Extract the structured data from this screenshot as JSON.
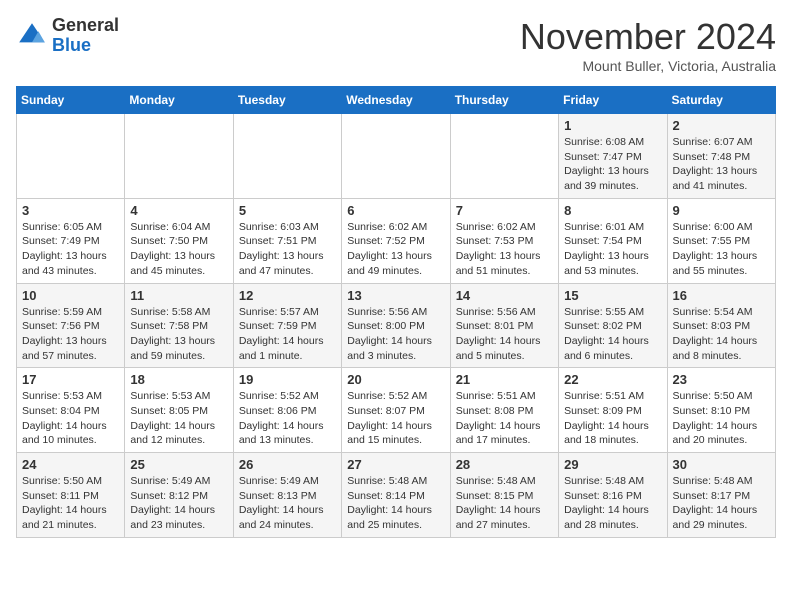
{
  "header": {
    "logo_general": "General",
    "logo_blue": "Blue",
    "month": "November 2024",
    "location": "Mount Buller, Victoria, Australia"
  },
  "days_of_week": [
    "Sunday",
    "Monday",
    "Tuesday",
    "Wednesday",
    "Thursday",
    "Friday",
    "Saturday"
  ],
  "weeks": [
    [
      {
        "day": "",
        "info": ""
      },
      {
        "day": "",
        "info": ""
      },
      {
        "day": "",
        "info": ""
      },
      {
        "day": "",
        "info": ""
      },
      {
        "day": "",
        "info": ""
      },
      {
        "day": "1",
        "info": "Sunrise: 6:08 AM\nSunset: 7:47 PM\nDaylight: 13 hours\nand 39 minutes."
      },
      {
        "day": "2",
        "info": "Sunrise: 6:07 AM\nSunset: 7:48 PM\nDaylight: 13 hours\nand 41 minutes."
      }
    ],
    [
      {
        "day": "3",
        "info": "Sunrise: 6:05 AM\nSunset: 7:49 PM\nDaylight: 13 hours\nand 43 minutes."
      },
      {
        "day": "4",
        "info": "Sunrise: 6:04 AM\nSunset: 7:50 PM\nDaylight: 13 hours\nand 45 minutes."
      },
      {
        "day": "5",
        "info": "Sunrise: 6:03 AM\nSunset: 7:51 PM\nDaylight: 13 hours\nand 47 minutes."
      },
      {
        "day": "6",
        "info": "Sunrise: 6:02 AM\nSunset: 7:52 PM\nDaylight: 13 hours\nand 49 minutes."
      },
      {
        "day": "7",
        "info": "Sunrise: 6:02 AM\nSunset: 7:53 PM\nDaylight: 13 hours\nand 51 minutes."
      },
      {
        "day": "8",
        "info": "Sunrise: 6:01 AM\nSunset: 7:54 PM\nDaylight: 13 hours\nand 53 minutes."
      },
      {
        "day": "9",
        "info": "Sunrise: 6:00 AM\nSunset: 7:55 PM\nDaylight: 13 hours\nand 55 minutes."
      }
    ],
    [
      {
        "day": "10",
        "info": "Sunrise: 5:59 AM\nSunset: 7:56 PM\nDaylight: 13 hours\nand 57 minutes."
      },
      {
        "day": "11",
        "info": "Sunrise: 5:58 AM\nSunset: 7:58 PM\nDaylight: 13 hours\nand 59 minutes."
      },
      {
        "day": "12",
        "info": "Sunrise: 5:57 AM\nSunset: 7:59 PM\nDaylight: 14 hours\nand 1 minute."
      },
      {
        "day": "13",
        "info": "Sunrise: 5:56 AM\nSunset: 8:00 PM\nDaylight: 14 hours\nand 3 minutes."
      },
      {
        "day": "14",
        "info": "Sunrise: 5:56 AM\nSunset: 8:01 PM\nDaylight: 14 hours\nand 5 minutes."
      },
      {
        "day": "15",
        "info": "Sunrise: 5:55 AM\nSunset: 8:02 PM\nDaylight: 14 hours\nand 6 minutes."
      },
      {
        "day": "16",
        "info": "Sunrise: 5:54 AM\nSunset: 8:03 PM\nDaylight: 14 hours\nand 8 minutes."
      }
    ],
    [
      {
        "day": "17",
        "info": "Sunrise: 5:53 AM\nSunset: 8:04 PM\nDaylight: 14 hours\nand 10 minutes."
      },
      {
        "day": "18",
        "info": "Sunrise: 5:53 AM\nSunset: 8:05 PM\nDaylight: 14 hours\nand 12 minutes."
      },
      {
        "day": "19",
        "info": "Sunrise: 5:52 AM\nSunset: 8:06 PM\nDaylight: 14 hours\nand 13 minutes."
      },
      {
        "day": "20",
        "info": "Sunrise: 5:52 AM\nSunset: 8:07 PM\nDaylight: 14 hours\nand 15 minutes."
      },
      {
        "day": "21",
        "info": "Sunrise: 5:51 AM\nSunset: 8:08 PM\nDaylight: 14 hours\nand 17 minutes."
      },
      {
        "day": "22",
        "info": "Sunrise: 5:51 AM\nSunset: 8:09 PM\nDaylight: 14 hours\nand 18 minutes."
      },
      {
        "day": "23",
        "info": "Sunrise: 5:50 AM\nSunset: 8:10 PM\nDaylight: 14 hours\nand 20 minutes."
      }
    ],
    [
      {
        "day": "24",
        "info": "Sunrise: 5:50 AM\nSunset: 8:11 PM\nDaylight: 14 hours\nand 21 minutes."
      },
      {
        "day": "25",
        "info": "Sunrise: 5:49 AM\nSunset: 8:12 PM\nDaylight: 14 hours\nand 23 minutes."
      },
      {
        "day": "26",
        "info": "Sunrise: 5:49 AM\nSunset: 8:13 PM\nDaylight: 14 hours\nand 24 minutes."
      },
      {
        "day": "27",
        "info": "Sunrise: 5:48 AM\nSunset: 8:14 PM\nDaylight: 14 hours\nand 25 minutes."
      },
      {
        "day": "28",
        "info": "Sunrise: 5:48 AM\nSunset: 8:15 PM\nDaylight: 14 hours\nand 27 minutes."
      },
      {
        "day": "29",
        "info": "Sunrise: 5:48 AM\nSunset: 8:16 PM\nDaylight: 14 hours\nand 28 minutes."
      },
      {
        "day": "30",
        "info": "Sunrise: 5:48 AM\nSunset: 8:17 PM\nDaylight: 14 hours\nand 29 minutes."
      }
    ]
  ]
}
